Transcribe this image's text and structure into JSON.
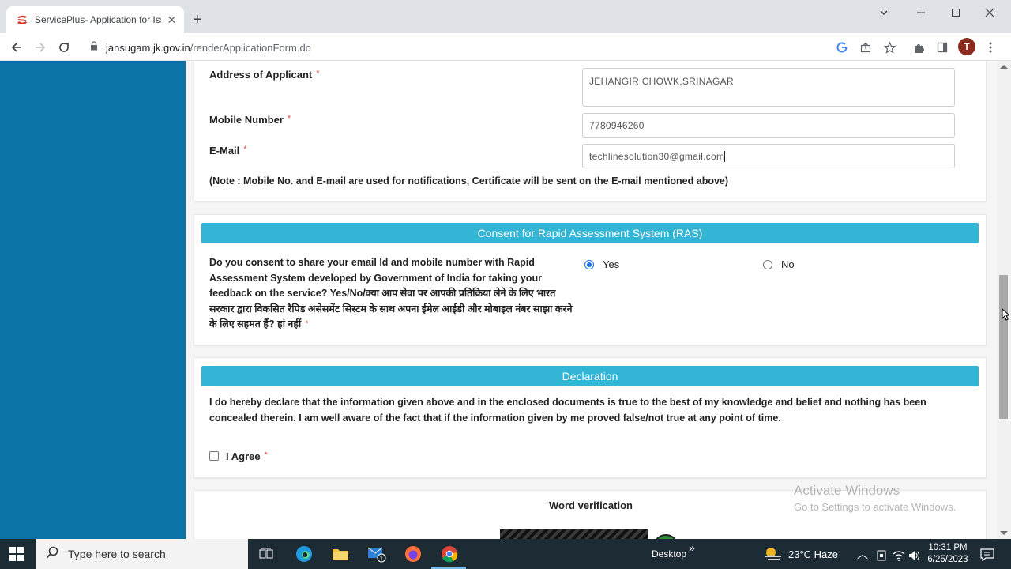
{
  "browser": {
    "tab_title": "ServicePlus- Application for Issuance",
    "url_host": "jansugam.jk.gov.in",
    "url_path": "/renderApplicationForm.do",
    "profile_initial": "T"
  },
  "form": {
    "address_label": "Address of Applicant",
    "address_value": "JEHANGIR CHOWK,SRINAGAR",
    "mobile_label": "Mobile Number",
    "mobile_value": "7780946260",
    "email_label": "E-Mail",
    "email_value": "techlinesolution30@gmail.com",
    "required_mark": "*",
    "note": "(Note : Mobile No. and E-mail are used for notifications, Certificate will be sent on the E-mail mentioned above)"
  },
  "ras": {
    "header": "Consent for Rapid Assessment System (RAS)",
    "question": "Do you consent to share your email Id and mobile number with Rapid Assessment System developed by Government of India for taking your feedback on the service? Yes/No/क्या आप सेवा पर आपकी प्रतिक्रिया लेने के लिए भारत सरकार द्वारा विकसित रैपिड असेसमेंट सिस्टम के साथ अपना ईमेल आईडी और मोबाइल नंबर साझा करने के लिए सहमत हैं? हां नहीं",
    "yes_label": "Yes",
    "no_label": "No",
    "selected": "Yes"
  },
  "declaration": {
    "header": "Declaration",
    "text": "I do hereby declare that the information given above and in the enclosed documents is true to the best of my knowledge and belief and nothing has been concealed therein. I am well aware of the fact that if the information given by me proved false/not true at any point of time.",
    "agree_label": "I Agree"
  },
  "word_verification": {
    "title": "Word verification"
  },
  "watermark": {
    "line1": "Activate Windows",
    "line2": "Go to Settings to activate Windows."
  },
  "taskbar": {
    "search_placeholder": "Type here to search",
    "desktop_label": "Desktop",
    "weather": "23°C  Haze",
    "time": "10:31 PM",
    "date": "6/25/2023",
    "mail_badge": "1"
  }
}
